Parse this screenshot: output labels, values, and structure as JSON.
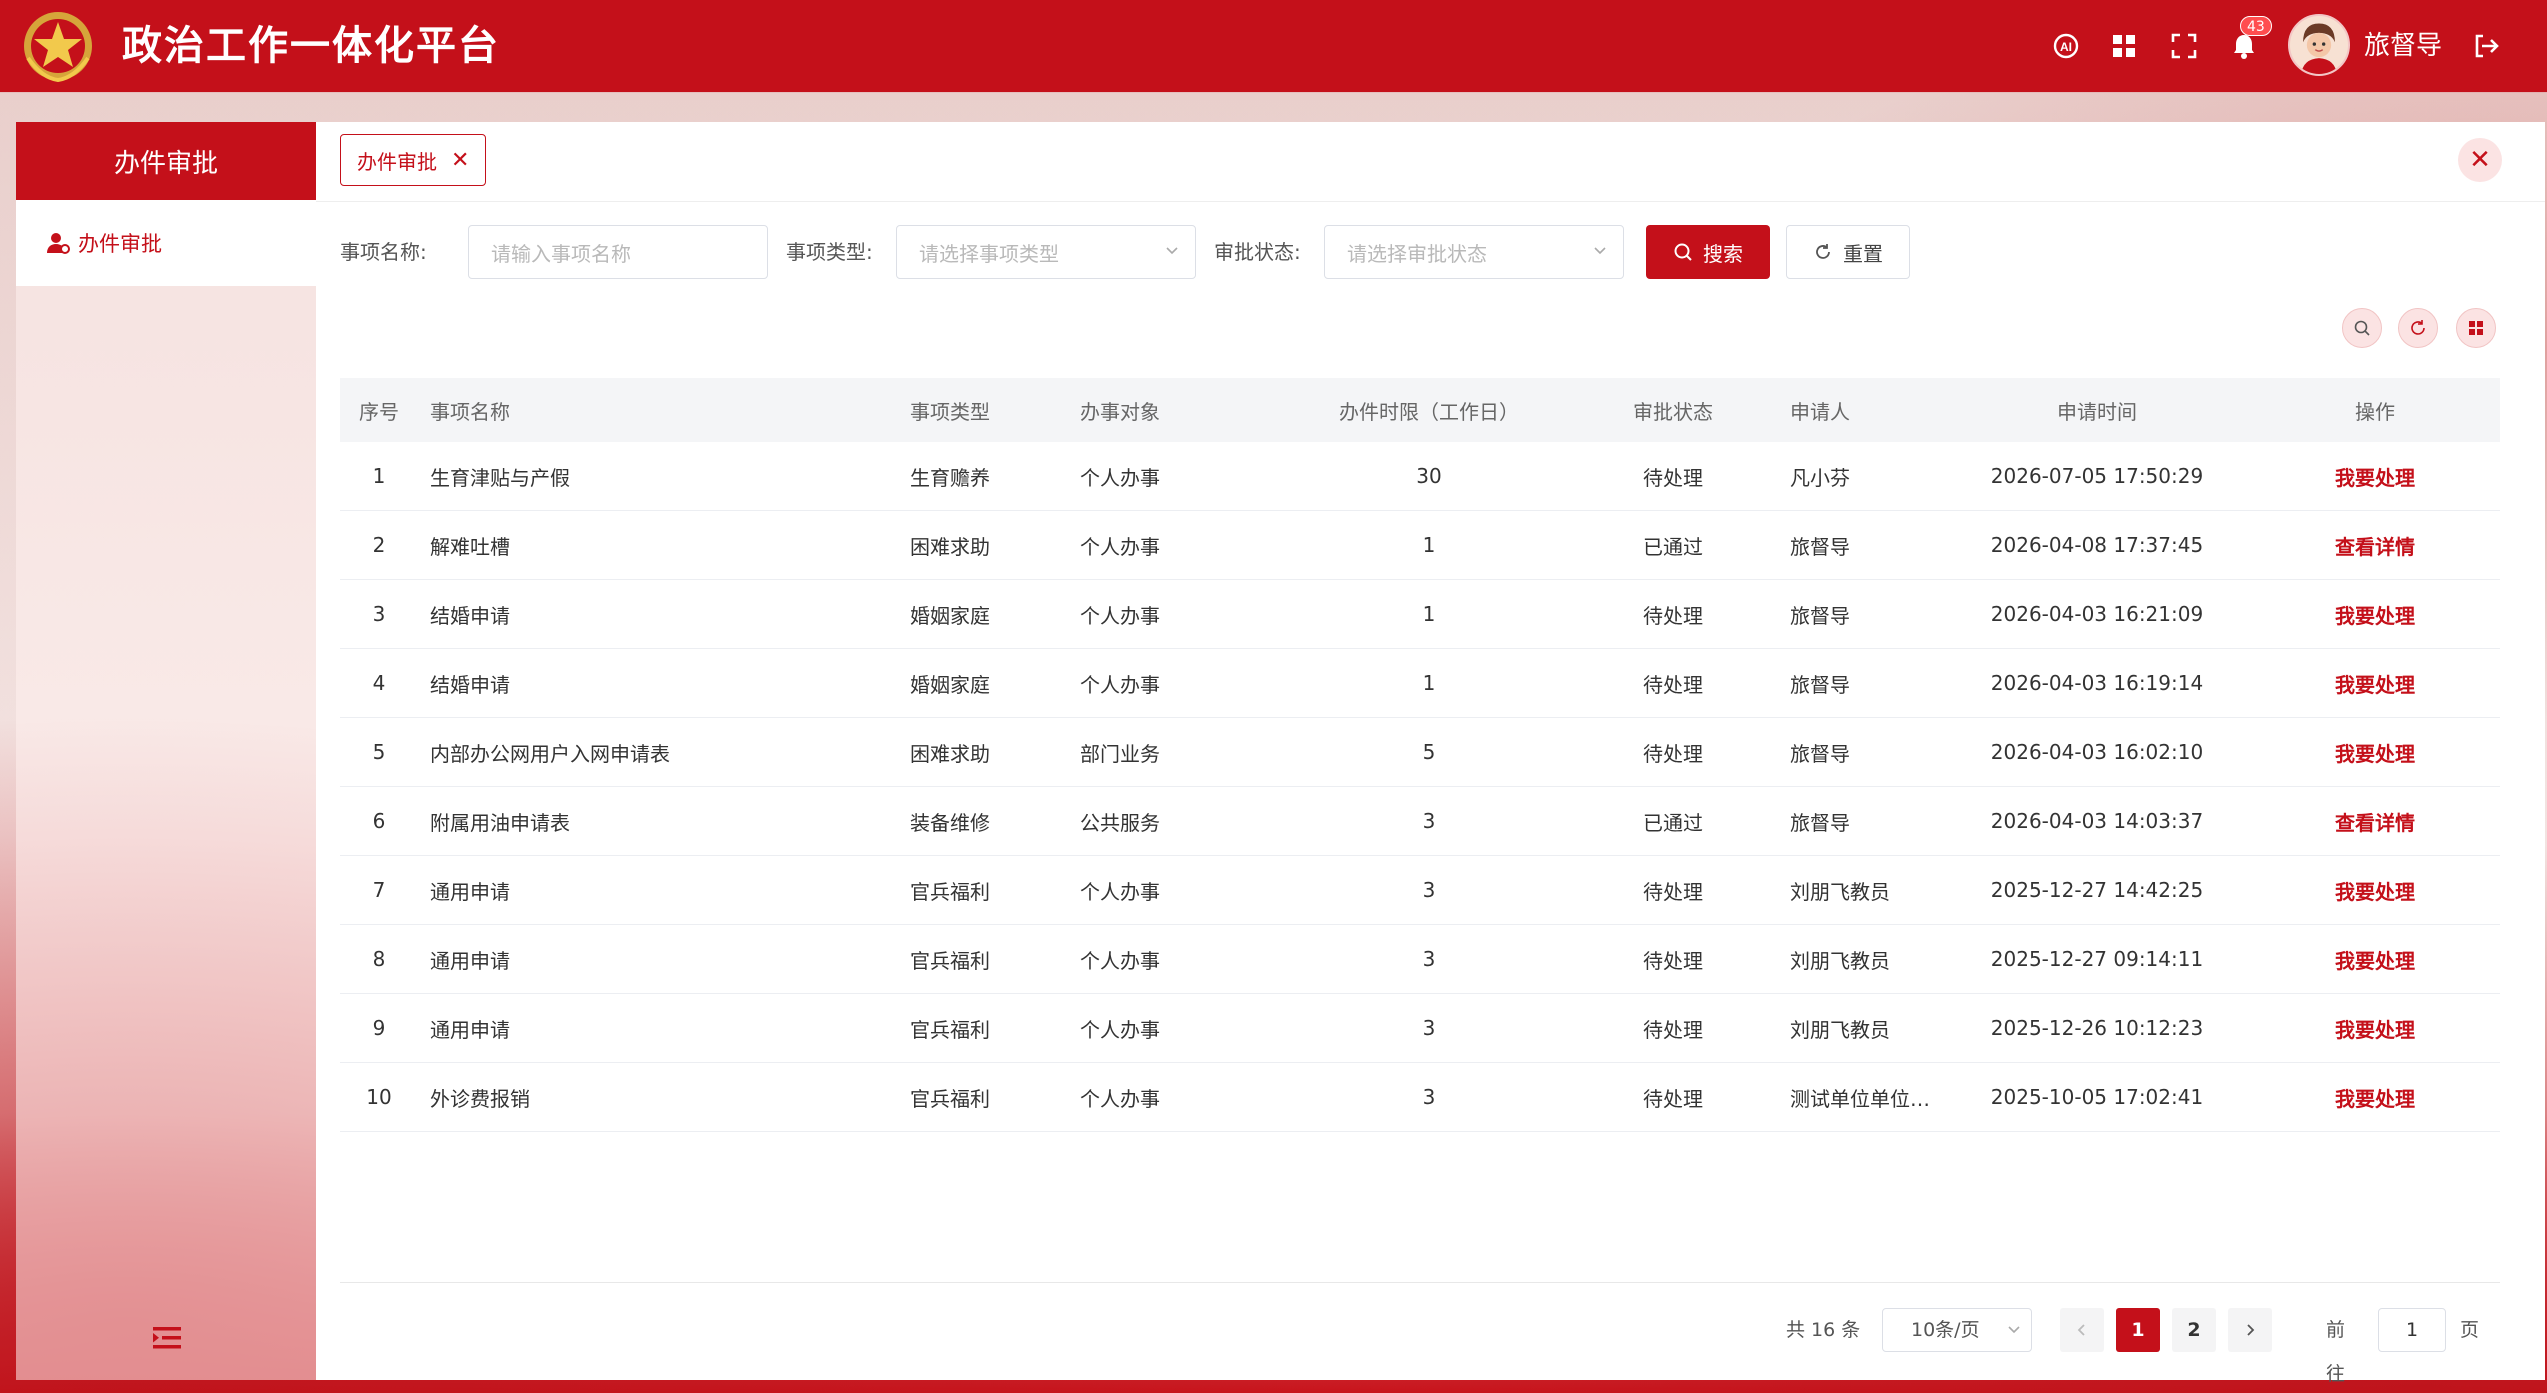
{
  "header": {
    "app_title": "政治工作一体化平台",
    "notification_count": "43",
    "user_name": "旅督导",
    "icons": [
      "ai-icon",
      "apps-grid-icon",
      "fullscreen-icon",
      "bell-icon",
      "logout-icon"
    ]
  },
  "sidebar": {
    "title": "办件审批",
    "items": [
      {
        "label": "办件审批",
        "icon": "user-icon"
      }
    ]
  },
  "tabs": [
    {
      "label": "办件审批"
    }
  ],
  "filters": {
    "name_label": "事项名称:",
    "name_placeholder": "请输入事项名称",
    "type_label": "事项类型:",
    "type_placeholder": "请选择事项类型",
    "status_label": "审批状态:",
    "status_placeholder": "请选择审批状态",
    "search_label": "搜索",
    "reset_label": "重置"
  },
  "table": {
    "columns": [
      "序号",
      "事项名称",
      "事项类型",
      "办事对象",
      "办件时限（工作日）",
      "审批状态",
      "申请人",
      "申请时间",
      "操作"
    ],
    "rows": [
      {
        "no": "1",
        "name": "生育津贴与产假",
        "type": "生育赡养",
        "target": "个人办事",
        "limit": "30",
        "status": "待处理",
        "applicant": "凡小芬",
        "time": "2026-07-05 17:50:29",
        "action": "我要处理"
      },
      {
        "no": "2",
        "name": "解难吐槽",
        "type": "困难求助",
        "target": "个人办事",
        "limit": "1",
        "status": "已通过",
        "applicant": "旅督导",
        "time": "2026-04-08 17:37:45",
        "action": "查看详情"
      },
      {
        "no": "3",
        "name": "结婚申请",
        "type": "婚姻家庭",
        "target": "个人办事",
        "limit": "1",
        "status": "待处理",
        "applicant": "旅督导",
        "time": "2026-04-03 16:21:09",
        "action": "我要处理"
      },
      {
        "no": "4",
        "name": "结婚申请",
        "type": "婚姻家庭",
        "target": "个人办事",
        "limit": "1",
        "status": "待处理",
        "applicant": "旅督导",
        "time": "2026-04-03 16:19:14",
        "action": "我要处理"
      },
      {
        "no": "5",
        "name": "内部办公网用户入网申请表",
        "type": "困难求助",
        "target": "部门业务",
        "limit": "5",
        "status": "待处理",
        "applicant": "旅督导",
        "time": "2026-04-03 16:02:10",
        "action": "我要处理"
      },
      {
        "no": "6",
        "name": "附属用油申请表",
        "type": "装备维修",
        "target": "公共服务",
        "limit": "3",
        "status": "已通过",
        "applicant": "旅督导",
        "time": "2026-04-03 14:03:37",
        "action": "查看详情"
      },
      {
        "no": "7",
        "name": "通用申请",
        "type": "官兵福利",
        "target": "个人办事",
        "limit": "3",
        "status": "待处理",
        "applicant": "刘朋飞教员",
        "time": "2025-12-27 14:42:25",
        "action": "我要处理"
      },
      {
        "no": "8",
        "name": "通用申请",
        "type": "官兵福利",
        "target": "个人办事",
        "limit": "3",
        "status": "待处理",
        "applicant": "刘朋飞教员",
        "time": "2025-12-27 09:14:11",
        "action": "我要处理"
      },
      {
        "no": "9",
        "name": "通用申请",
        "type": "官兵福利",
        "target": "个人办事",
        "limit": "3",
        "status": "待处理",
        "applicant": "刘朋飞教员",
        "time": "2025-12-26 10:12:23",
        "action": "我要处理"
      },
      {
        "no": "10",
        "name": "外诊费报销",
        "type": "官兵福利",
        "target": "个人办事",
        "limit": "3",
        "status": "待处理",
        "applicant": "测试单位单位管...",
        "time": "2025-10-05 17:02:41",
        "action": "我要处理"
      }
    ]
  },
  "pagination": {
    "total": "共 16 条",
    "page_size": "10条/页",
    "pages": [
      "1",
      "2"
    ],
    "current": "1",
    "goto_label": "前往",
    "goto_value": "1",
    "page_suffix": "页"
  },
  "colors": {
    "primary": "#c4101a",
    "header_bg": "#c4101a"
  }
}
